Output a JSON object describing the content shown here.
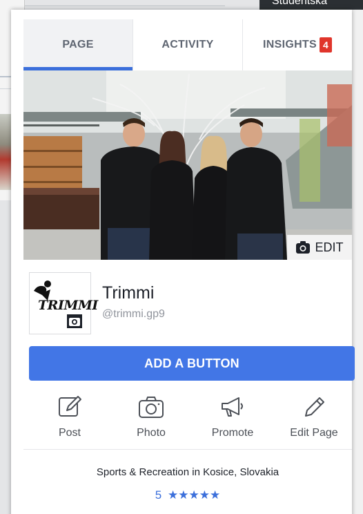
{
  "background": {
    "top_right_label": "Studentská"
  },
  "tabs": [
    {
      "label": "PAGE",
      "active": true
    },
    {
      "label": "ACTIVITY",
      "active": false
    },
    {
      "label": "INSIGHTS",
      "active": false,
      "badge": "4"
    }
  ],
  "cover": {
    "edit_label": "EDIT",
    "edit_icon": "camera-icon"
  },
  "profile": {
    "logo_text": "TRIMMI",
    "name": "Trimmi",
    "handle": "@trimmi.gp9"
  },
  "add_button": {
    "label": "ADD A BUTTON"
  },
  "actions": [
    {
      "label": "Post",
      "icon": "compose-icon"
    },
    {
      "label": "Photo",
      "icon": "camera-icon"
    },
    {
      "label": "Promote",
      "icon": "megaphone-icon"
    },
    {
      "label": "Edit Page",
      "icon": "pencil-icon"
    }
  ],
  "info": {
    "category": "Sports & Recreation in Kosice, Slovakia",
    "rating_value": "5",
    "rating_stars": "★★★★★"
  },
  "colors": {
    "accent": "#4276e6",
    "tab_indicator": "#3b6fdb",
    "badge": "#e0352b",
    "rating": "#3b6fdb"
  }
}
